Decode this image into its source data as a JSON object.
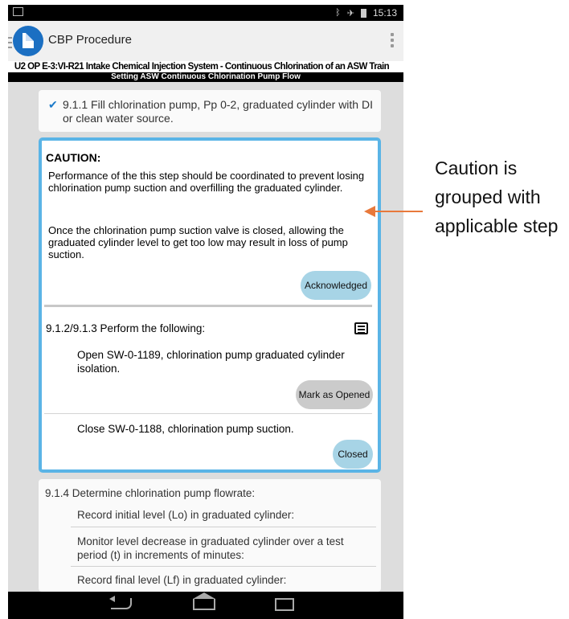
{
  "app": {
    "title": "CBP Procedure"
  },
  "procedure": {
    "title": "U2 OP E-3:VI-R21 Intake Chemical Injection System - Continuous Chlorination of an ASW Train",
    "section": "Setting ASW Continuous Chlorination Pump Flow"
  },
  "status_bar": {
    "time": "15:13",
    "icons": [
      "bluetooth-icon",
      "airplane-mode-icon",
      "battery-icon"
    ]
  },
  "step1": {
    "check_icon": "checkmark-icon",
    "text": "9.1.1 Fill chlorination pump, Pp 0-2, graduated cylinder with DI or clean water source."
  },
  "caution": {
    "heading": "CAUTION:",
    "para1": "Performance of the this step should be coordinated to prevent losing chlorination pump suction and overfilling the graduated cylinder.",
    "para2": "Once the chlorination pump suction valve is closed, allowing the graduated cylinder level to get too low may result in loss of pump suction.",
    "button": "Acknowledged"
  },
  "step2": {
    "label": "9.1.2/9.1.3 Perform the following:",
    "sub1": {
      "text": "Open SW-0-1189, chlorination pump graduated cylinder isolation.",
      "button": "Mark as Opened"
    },
    "sub2": {
      "text": "Close SW-0-1188, chlorination pump suction.",
      "button": "Closed"
    }
  },
  "step4": {
    "label": "9.1.4 Determine chlorination pump flowrate:",
    "items": [
      "Record initial level (Lo) in graduated cylinder:",
      "Monitor level decrease in graduated cylinder over a test period (t) in increments of minutes:",
      "Record final level (Lf) in graduated cylinder:"
    ]
  },
  "annotation": {
    "text": "Caution is grouped with applicable step"
  },
  "colors": {
    "accent": "#1b6fc2",
    "caution_border": "#5ab4e6",
    "pill_blue": "#a7d4e6",
    "pill_gray": "#cbcbcb",
    "arrow": "#e8793b"
  }
}
